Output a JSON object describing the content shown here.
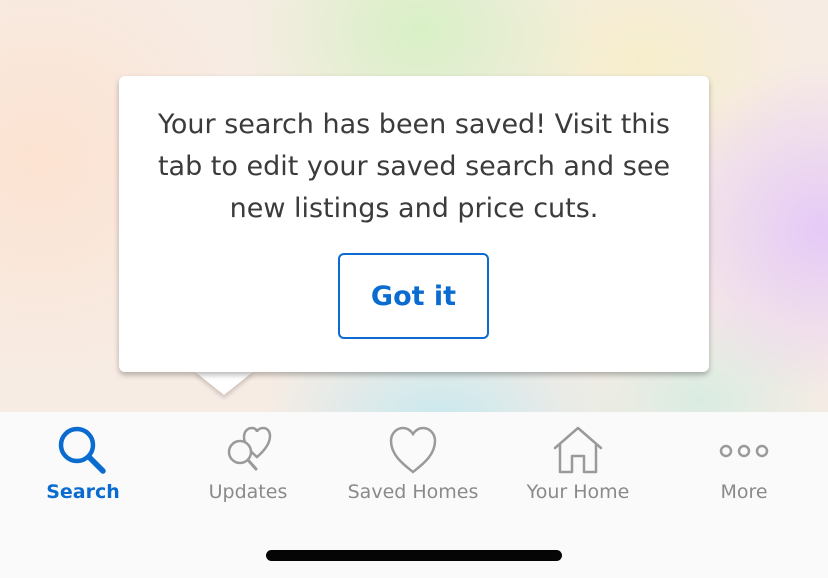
{
  "tooltip": {
    "message": "Your search has been saved! Visit this tab to edit your saved search and see new listings and price cuts.",
    "button_label": "Got it"
  },
  "tabs": [
    {
      "id": "search",
      "label": "Search",
      "icon": "search-icon",
      "active": true
    },
    {
      "id": "updates",
      "label": "Updates",
      "icon": "heart-search-icon",
      "active": false
    },
    {
      "id": "saved-homes",
      "label": "Saved Homes",
      "icon": "heart-icon",
      "active": false
    },
    {
      "id": "your-home",
      "label": "Your Home",
      "icon": "house-icon",
      "active": false
    },
    {
      "id": "more",
      "label": "More",
      "icon": "more-dots-icon",
      "active": false
    }
  ],
  "colors": {
    "accent": "#0a6cd0",
    "inactive": "#8a8a8a",
    "text": "#3b3b3b"
  }
}
